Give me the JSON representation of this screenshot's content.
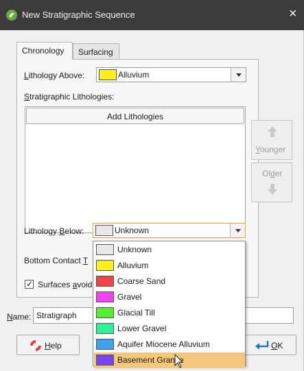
{
  "window": {
    "title": "New Stratigraphic Sequence",
    "close_glyph": "×"
  },
  "tabs": [
    {
      "label": "Chronology",
      "active": true
    },
    {
      "label": "Surfacing",
      "active": false
    }
  ],
  "lithology_above": {
    "label": "Lithology Above:",
    "value": "Alluvium",
    "color": "#ffee22"
  },
  "stratigraphic_lithologies": {
    "label": "Stratigraphic Lithologies:",
    "add_button": "Add Lithologies"
  },
  "side_buttons": {
    "younger": "Younger",
    "older": "Older"
  },
  "lithology_below": {
    "label": "Lithology Below:",
    "value": "Unknown",
    "color": "#e8e8e8"
  },
  "bottom_contact": {
    "label": "Bottom Contact T"
  },
  "surfaces_avoid": {
    "label": "Surfaces avoid",
    "checked": true,
    "check_glyph": "✓"
  },
  "name_field": {
    "label": "Name:",
    "value": "Stratigraph"
  },
  "footer": {
    "help": "Help",
    "ok": "OK"
  },
  "dropdown_options": [
    {
      "label": "Unknown",
      "color": "#e8e8e8"
    },
    {
      "label": "Alluvium",
      "color": "#ffee22"
    },
    {
      "label": "Coarse Sand",
      "color": "#ef4444"
    },
    {
      "label": "Gravel",
      "color": "#ee44ee"
    },
    {
      "label": "Glacial Till",
      "color": "#55ee33"
    },
    {
      "label": "Lower Gravel",
      "color": "#33ee99"
    },
    {
      "label": "Aquifer Miocene Alluvium",
      "color": "#3ea2ee"
    },
    {
      "label": "Basement Granite",
      "color": "#7744ee",
      "highlighted": true
    }
  ]
}
